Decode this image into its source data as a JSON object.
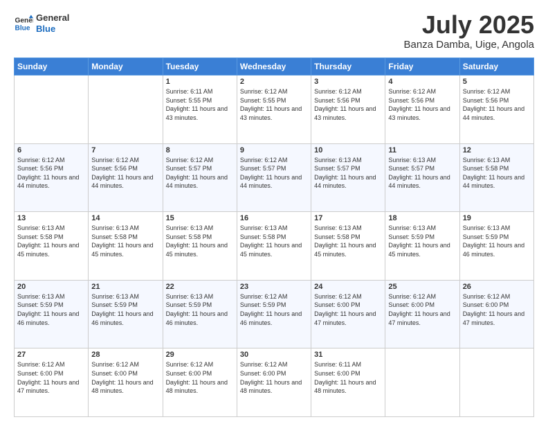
{
  "logo": {
    "line1": "General",
    "line2": "Blue"
  },
  "title": "July 2025",
  "location": "Banza Damba, Uige, Angola",
  "days_of_week": [
    "Sunday",
    "Monday",
    "Tuesday",
    "Wednesday",
    "Thursday",
    "Friday",
    "Saturday"
  ],
  "weeks": [
    [
      {
        "day": null
      },
      {
        "day": null
      },
      {
        "day": "1",
        "sunrise": "6:11 AM",
        "sunset": "5:55 PM",
        "daylight": "11 hours and 43 minutes."
      },
      {
        "day": "2",
        "sunrise": "6:12 AM",
        "sunset": "5:55 PM",
        "daylight": "11 hours and 43 minutes."
      },
      {
        "day": "3",
        "sunrise": "6:12 AM",
        "sunset": "5:56 PM",
        "daylight": "11 hours and 43 minutes."
      },
      {
        "day": "4",
        "sunrise": "6:12 AM",
        "sunset": "5:56 PM",
        "daylight": "11 hours and 43 minutes."
      },
      {
        "day": "5",
        "sunrise": "6:12 AM",
        "sunset": "5:56 PM",
        "daylight": "11 hours and 44 minutes."
      }
    ],
    [
      {
        "day": "6",
        "sunrise": "6:12 AM",
        "sunset": "5:56 PM",
        "daylight": "11 hours and 44 minutes."
      },
      {
        "day": "7",
        "sunrise": "6:12 AM",
        "sunset": "5:56 PM",
        "daylight": "11 hours and 44 minutes."
      },
      {
        "day": "8",
        "sunrise": "6:12 AM",
        "sunset": "5:57 PM",
        "daylight": "11 hours and 44 minutes."
      },
      {
        "day": "9",
        "sunrise": "6:12 AM",
        "sunset": "5:57 PM",
        "daylight": "11 hours and 44 minutes."
      },
      {
        "day": "10",
        "sunrise": "6:13 AM",
        "sunset": "5:57 PM",
        "daylight": "11 hours and 44 minutes."
      },
      {
        "day": "11",
        "sunrise": "6:13 AM",
        "sunset": "5:57 PM",
        "daylight": "11 hours and 44 minutes."
      },
      {
        "day": "12",
        "sunrise": "6:13 AM",
        "sunset": "5:58 PM",
        "daylight": "11 hours and 44 minutes."
      }
    ],
    [
      {
        "day": "13",
        "sunrise": "6:13 AM",
        "sunset": "5:58 PM",
        "daylight": "11 hours and 45 minutes."
      },
      {
        "day": "14",
        "sunrise": "6:13 AM",
        "sunset": "5:58 PM",
        "daylight": "11 hours and 45 minutes."
      },
      {
        "day": "15",
        "sunrise": "6:13 AM",
        "sunset": "5:58 PM",
        "daylight": "11 hours and 45 minutes."
      },
      {
        "day": "16",
        "sunrise": "6:13 AM",
        "sunset": "5:58 PM",
        "daylight": "11 hours and 45 minutes."
      },
      {
        "day": "17",
        "sunrise": "6:13 AM",
        "sunset": "5:58 PM",
        "daylight": "11 hours and 45 minutes."
      },
      {
        "day": "18",
        "sunrise": "6:13 AM",
        "sunset": "5:59 PM",
        "daylight": "11 hours and 45 minutes."
      },
      {
        "day": "19",
        "sunrise": "6:13 AM",
        "sunset": "5:59 PM",
        "daylight": "11 hours and 46 minutes."
      }
    ],
    [
      {
        "day": "20",
        "sunrise": "6:13 AM",
        "sunset": "5:59 PM",
        "daylight": "11 hours and 46 minutes."
      },
      {
        "day": "21",
        "sunrise": "6:13 AM",
        "sunset": "5:59 PM",
        "daylight": "11 hours and 46 minutes."
      },
      {
        "day": "22",
        "sunrise": "6:13 AM",
        "sunset": "5:59 PM",
        "daylight": "11 hours and 46 minutes."
      },
      {
        "day": "23",
        "sunrise": "6:12 AM",
        "sunset": "5:59 PM",
        "daylight": "11 hours and 46 minutes."
      },
      {
        "day": "24",
        "sunrise": "6:12 AM",
        "sunset": "6:00 PM",
        "daylight": "11 hours and 47 minutes."
      },
      {
        "day": "25",
        "sunrise": "6:12 AM",
        "sunset": "6:00 PM",
        "daylight": "11 hours and 47 minutes."
      },
      {
        "day": "26",
        "sunrise": "6:12 AM",
        "sunset": "6:00 PM",
        "daylight": "11 hours and 47 minutes."
      }
    ],
    [
      {
        "day": "27",
        "sunrise": "6:12 AM",
        "sunset": "6:00 PM",
        "daylight": "11 hours and 47 minutes."
      },
      {
        "day": "28",
        "sunrise": "6:12 AM",
        "sunset": "6:00 PM",
        "daylight": "11 hours and 48 minutes."
      },
      {
        "day": "29",
        "sunrise": "6:12 AM",
        "sunset": "6:00 PM",
        "daylight": "11 hours and 48 minutes."
      },
      {
        "day": "30",
        "sunrise": "6:12 AM",
        "sunset": "6:00 PM",
        "daylight": "11 hours and 48 minutes."
      },
      {
        "day": "31",
        "sunrise": "6:11 AM",
        "sunset": "6:00 PM",
        "daylight": "11 hours and 48 minutes."
      },
      {
        "day": null
      },
      {
        "day": null
      }
    ]
  ]
}
